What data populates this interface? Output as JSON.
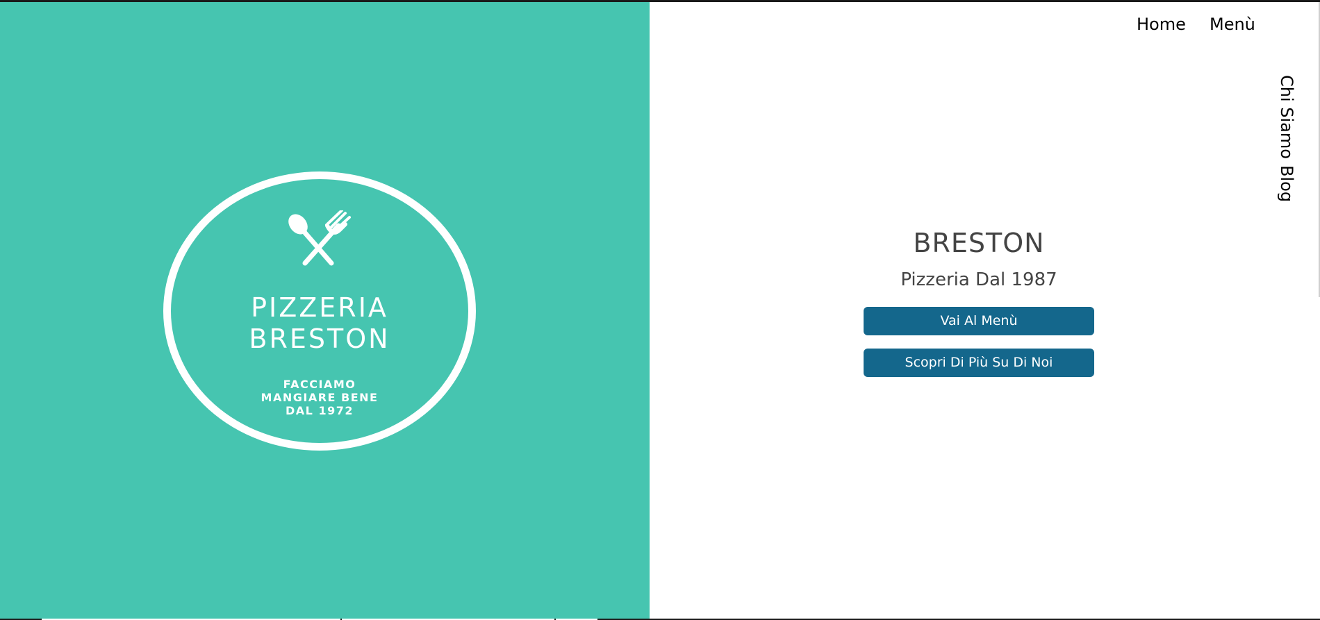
{
  "nav": {
    "home": "Home",
    "menu": "Menù",
    "about": "Chi Siamo",
    "blog": "Blog"
  },
  "logo": {
    "icon": "crossed-spoon-fork-icon",
    "line1": "PIZZERIA",
    "line2": "BRESTON",
    "tagline1": "FACCIAMO",
    "tagline2": "MANGIARE BENE",
    "tagline3": "DAL 1972"
  },
  "hero": {
    "title": "BRESTON",
    "subtitle": "Pizzeria Dal 1987",
    "menu_button": "Vai Al Menù",
    "about_button": "Scopri Di Più Su Di Noi"
  },
  "colors": {
    "left_panel": "#46c5b0",
    "button": "#14678c",
    "heading_text": "#444444"
  }
}
